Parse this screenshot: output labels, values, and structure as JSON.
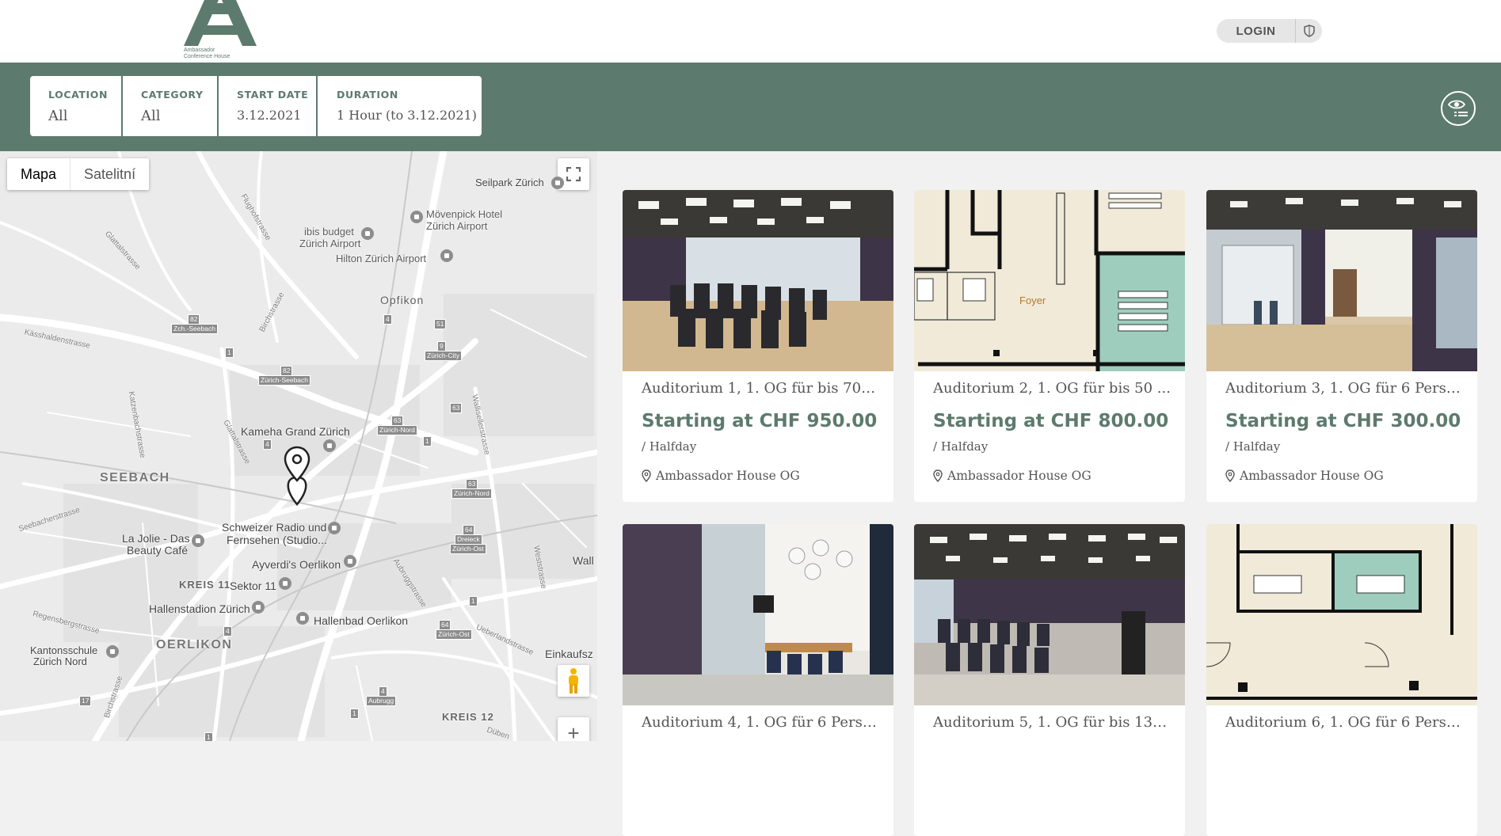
{
  "header": {
    "logo_text_line1": "Ambassador",
    "logo_text_line2": "Conference House",
    "login_label": "LOGIN",
    "shield_icon": "shield-icon"
  },
  "filters": [
    {
      "label": "LOCATION",
      "value": "All"
    },
    {
      "label": "CATEGORY",
      "value": "All"
    },
    {
      "label": "START DATE",
      "value": "3.12.2021"
    },
    {
      "label": "DURATION",
      "value": "1 Hour (to 3.12.2021)"
    }
  ],
  "map": {
    "view_options": [
      "Mapa",
      "Satelitní"
    ],
    "selected_view": "Mapa",
    "zoom_in_label": "+",
    "places": {
      "seilpark": "Seilpark Zürich",
      "movenpick1": "Mövenpick Hotel",
      "movenpick2": "Zürich Airport",
      "ibis1": "ibis budget",
      "ibis2": "Zürich Airport",
      "hilton": "Hilton Zürich Airport",
      "opfikon": "Opfikon",
      "kameha": "Kameha Grand Zürich",
      "seebach": "SEEBACH",
      "schweizer1": "Schweizer Radio und",
      "schweizer2": "Fernsehen (Studio...",
      "lajolie1": "La Jolie - Das",
      "lajolie2": "Beauty Café",
      "ayverdi": "Ayverdi's Oerlikon",
      "kreis11": "KREIS 11",
      "sektor11": "Sektor 11",
      "hallenstadion": "Hallenstadion Zürich",
      "hallenbad": "Hallenbad Oerlikon",
      "oerlikon": "OERLIKON",
      "kantonsschule1": "Kantonsschule",
      "kantonsschule2": "Zürich Nord",
      "kreis12": "KREIS 12",
      "wall": "Wall",
      "einkaufsz": "Einkaufsz"
    },
    "streets": {
      "glattalstrasse": "Glattalstrasse",
      "flughofstrasse": "Flughofstrasse",
      "kasshaldenstrasse": "Kässhaldenstrasse",
      "birchstrasse": "Birchstrasse",
      "katzenbach": "Katzenbachstrasse",
      "glattalstrasse2": "Glattalstrasse",
      "wallisellen": "Wallisellerstrasse",
      "seebacher": "Seebacherstrasse",
      "regensberg": "Regensbergstrasse",
      "aubrugg": "Aubruggstrasse",
      "ueberland": "Ueberlandstrasse",
      "weststrasse": "Weststrasse",
      "birchstrasse2": "Birchstrasse",
      "dubend": "Düben"
    },
    "road_shields": {
      "s82a": "82",
      "zchseebach": "Zch.-Seebach",
      "s82b": "82",
      "zuerichseebach": "Zürich-Seebach",
      "s1a": "1",
      "s4a": "4",
      "s51": "51",
      "s9": "9",
      "zuerichcity": "Zürich-City",
      "s63a": "63",
      "zuerichnord1": "Zürich-Nord",
      "s63b": "63",
      "s1b": "1",
      "s63c": "63",
      "zuerichnord2": "Zürich-Nord",
      "s64a": "64",
      "dreieck": "Dreieck",
      "zuerichost1": "Zürich-Ost",
      "s4b": "4",
      "s4c": "4",
      "s1c": "1",
      "s64b": "64",
      "zuerichost2": "Zürich-Ost",
      "s4d": "4",
      "aubrugg": "Aubrugg",
      "s17": "17",
      "s1d": "1",
      "s1e": "1"
    }
  },
  "rooms": [
    {
      "title": "Auditorium 1, 1. OG für bis 70 P...",
      "price": "Starting at CHF 950.00",
      "per": "/ Halfday",
      "location": "Ambassador House OG"
    },
    {
      "title": "Auditorium 2, 1. OG für bis 50 ...",
      "price": "Starting at CHF 800.00",
      "per": "/ Halfday",
      "location": "Ambassador House OG",
      "plan_label": "Foyer"
    },
    {
      "title": "Auditorium 3, 1. OG für 6 Perso...",
      "price": "Starting at CHF 300.00",
      "per": "/ Halfday",
      "location": "Ambassador House OG"
    },
    {
      "title": "Auditorium 4, 1. OG für 6 Perso..."
    },
    {
      "title": "Auditorium 5, 1. OG für bis 130 ..."
    },
    {
      "title": "Auditorium 6, 1. OG für 6 Perso..."
    }
  ],
  "colors": {
    "brand_green": "#5d7a6e",
    "mint": "#9ecdbd",
    "plan_beige": "#f1ead9"
  }
}
